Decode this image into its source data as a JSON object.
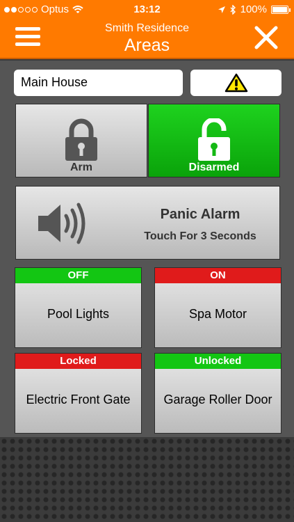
{
  "status_bar": {
    "carrier": "Optus",
    "time": "13:12",
    "battery": "100%",
    "signal_bars_filled": 2,
    "signal_bars_total": 5
  },
  "header": {
    "subtitle": "Smith Residence",
    "title": "Areas"
  },
  "area": {
    "selected": "Main House"
  },
  "arm_controls": {
    "arm_label": "Arm",
    "disarm_label": "Disarmed",
    "state": "disarmed"
  },
  "panic": {
    "title": "Panic Alarm",
    "subtitle": "Touch For 3 Seconds"
  },
  "devices": [
    {
      "status": "OFF",
      "name": "Pool Lights",
      "status_color": "#13c613"
    },
    {
      "status": "ON",
      "name": "Spa Motor",
      "status_color": "#e01b1b"
    },
    {
      "status": "Locked",
      "name": "Electric Front Gate",
      "status_color": "#e01b1b"
    },
    {
      "status": "Unlocked",
      "name": "Garage Roller Door",
      "status_color": "#13c613"
    }
  ],
  "colors": {
    "accent": "#ff7a00",
    "active_green": "#13c613",
    "alert_red": "#e01b1b"
  }
}
